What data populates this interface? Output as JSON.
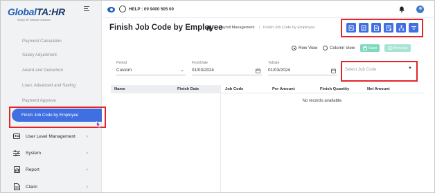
{
  "brand": {
    "name_a": "Global",
    "name_b": "TA:HR",
    "tagline": "Simply HR Software Solutions"
  },
  "topbar": {
    "help": "HELP : 09 9400 505 00"
  },
  "sidebar": {
    "sub_items": [
      {
        "label": "Payment Calculation"
      },
      {
        "label": "Salary Adjustment"
      },
      {
        "label": "Award and Deduction"
      },
      {
        "label": "Loan, Advanced and Saving"
      },
      {
        "label": "Payment Approve"
      }
    ],
    "active_item": {
      "label": "Finish Job Code by Employee"
    },
    "main_items": [
      {
        "label": "User Level Management",
        "icon": "user-level-icon"
      },
      {
        "label": "System",
        "icon": "sliders-icon"
      },
      {
        "label": "Report",
        "icon": "report-icon"
      },
      {
        "label": "Claim",
        "icon": "claim-icon"
      }
    ]
  },
  "page": {
    "title": "Finish Job Code by Employee",
    "breadcrumb": [
      "Payroll Management",
      "Finish Job Code by Employee"
    ]
  },
  "toolbar": {
    "icons": [
      "export-excel-icon",
      "import-icon",
      "document-icon",
      "print-icon",
      "hierarchy-icon",
      "filter-icon"
    ],
    "accent": "#3f6fe0"
  },
  "view": {
    "row_view": "Row View",
    "column_view": "Column View",
    "selected": "Row View",
    "save": "Save",
    "preview": "Preview"
  },
  "filters": {
    "period_label": "Period",
    "period_value": "Custom",
    "from_label": "FromDate",
    "from_value": "01/03/2024",
    "to_label": "ToDate",
    "to_value": "01/03/2024",
    "job_code_placeholder": "Select Job Code"
  },
  "table": {
    "columns": [
      "Name",
      "Finish Date",
      "Job Code",
      "Per Amount",
      "Finish Quantity",
      "Net Amount"
    ],
    "empty_message": "No records available."
  },
  "colors": {
    "highlight_box": "#e0262b",
    "primary": "#3f6fe0",
    "save_button": "#7fd8c0"
  }
}
